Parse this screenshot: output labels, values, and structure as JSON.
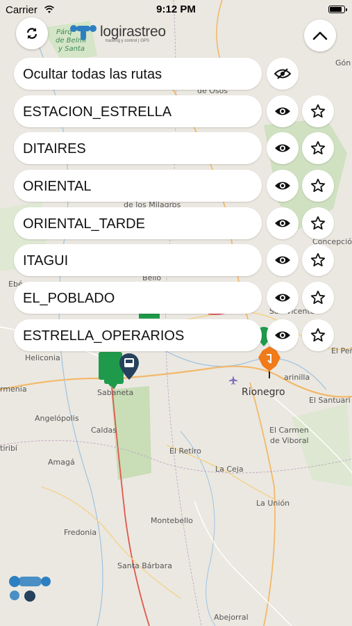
{
  "status_bar": {
    "carrier": "Carrier",
    "time": "9:12 PM"
  },
  "header": {
    "logo_text": "logirastreo",
    "logo_sub": "tracking y control | GPS"
  },
  "routes_panel": {
    "hide_all_label": "Ocultar todas las rutas",
    "routes": [
      {
        "label": "ESTACION_ESTRELLA"
      },
      {
        "label": "DITAIRES"
      },
      {
        "label": "ORIENTAL"
      },
      {
        "label": "ORIENTAL_TARDE"
      },
      {
        "label": "ITAGUI"
      },
      {
        "label": "EL_POBLADO"
      },
      {
        "label": "ESTRELLA_OPERARIOS"
      }
    ]
  },
  "map": {
    "places": {
      "gomez": "Gón",
      "de_osos": "de Osos",
      "milagros": "de los Milagros",
      "concepcion": "Concepció",
      "bello": "Bello",
      "ebe": "Ebé",
      "san_vicente": "San Vicente",
      "heliconia": "Heliconia",
      "el_pe": "El Peñ",
      "armenia": "rmenia",
      "sabaneta": "Sabaneta",
      "rionegro": "Rionegro",
      "marinilla": "arinilla",
      "el_santuario": "El Santuari",
      "angelopolis": "Angelópolis",
      "caldas": "Caldas",
      "el_carmen": "El Carmen",
      "de_viboral": "de Viboral",
      "titiribi": "tiribí",
      "amaga": "Amagá",
      "el_retiro": "El Retiro",
      "la_ceja": "La Ceja",
      "la_union": "La Unión",
      "montebello": "Montebello",
      "fredonia": "Fredonia",
      "santa_barbara": "Santa Bárbara",
      "abejorral": "Abejorral",
      "parque_1": "Párq",
      "parque_2": "de Belmi",
      "parque_3": "y Santa"
    }
  },
  "colors": {
    "accent_blue": "#2d7fc1",
    "marker_green": "#1e9a4a",
    "marker_orange": "#f07b1a",
    "marker_navy": "#26415c"
  }
}
